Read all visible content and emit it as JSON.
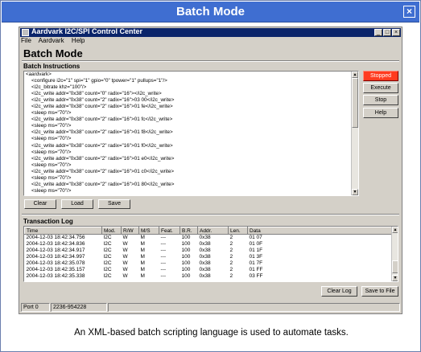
{
  "banner": {
    "title": "Batch Mode",
    "close": "×"
  },
  "window": {
    "title": "Aardvark I2C/SPI Control Center",
    "controls": {
      "minimize": "_",
      "maximize": "□",
      "close": "×"
    },
    "menu": [
      "File",
      "Aardvark",
      "Help"
    ]
  },
  "panel": {
    "title": "Batch Mode",
    "instructions_label": "Batch Instructions",
    "script_lines": [
      "<aardvark>",
      "    <configure i2c=\"1\" spi=\"1\" gpio=\"0\" tpower=\"1\" pullups=\"1\"/>",
      "    <i2c_bitrate khz=\"100\"/>",
      "    <i2c_write addr=\"0x38\" count=\"0\" radix=\"16\"></i2c_write>",
      "    <i2c_write addr=\"0x38\" count=\"2\" radix=\"16\">03 00</i2c_write>",
      "    <i2c_write addr=\"0x38\" count=\"2\" radix=\"16\">01 fe</i2c_write>",
      "    <sleep ms=\"70\"/>",
      "    <i2c_write addr=\"0x38\" count=\"2\" radix=\"16\">01 fc</i2c_write>",
      "    <sleep ms=\"70\"/>",
      "    <i2c_write addr=\"0x38\" count=\"2\" radix=\"16\">01 f8</i2c_write>",
      "    <sleep ms=\"70\"/>",
      "    <i2c_write addr=\"0x38\" count=\"2\" radix=\"16\">01 f0</i2c_write>",
      "    <sleep ms=\"70\"/>",
      "    <i2c_write addr=\"0x38\" count=\"2\" radix=\"16\">01 e0</i2c_write>",
      "    <sleep ms=\"70\"/>",
      "    <i2c_write addr=\"0x38\" count=\"2\" radix=\"16\">01 c0</i2c_write>",
      "    <sleep ms=\"70\"/>",
      "    <i2c_write addr=\"0x38\" count=\"2\" radix=\"16\">01 80</i2c_write>",
      "    <sleep ms=\"70\"/>"
    ],
    "side_buttons": {
      "status": "Stopped",
      "execute": "Execute",
      "stop": "Stop",
      "help": "Help"
    },
    "bottom_buttons": {
      "clear": "Clear",
      "load": "Load",
      "save": "Save"
    },
    "status_color": "#ff3b1f"
  },
  "log": {
    "label": "Transaction Log",
    "columns": [
      "Time",
      "Mod.",
      "R/W",
      "M/S",
      "Feat.",
      "B.R.",
      "Addr.",
      "Len.",
      "Data"
    ],
    "rows": [
      [
        "2004-12-03 18:42:34.756",
        "I2C",
        "W",
        "M",
        "---",
        "100",
        "0x38",
        "2",
        "01 07"
      ],
      [
        "2004-12-03 18:42:34.836",
        "I2C",
        "W",
        "M",
        "---",
        "100",
        "0x38",
        "2",
        "01 0F"
      ],
      [
        "2004-12-03 18:42:34.917",
        "I2C",
        "W",
        "M",
        "---",
        "100",
        "0x38",
        "2",
        "01 1F"
      ],
      [
        "2004-12-03 18:42:34.997",
        "I2C",
        "W",
        "M",
        "---",
        "100",
        "0x38",
        "2",
        "01 3F"
      ],
      [
        "2004-12-03 18:42:35.078",
        "I2C",
        "W",
        "M",
        "---",
        "100",
        "0x38",
        "2",
        "01 7F"
      ],
      [
        "2004-12-03 18:42:35.157",
        "I2C",
        "W",
        "M",
        "---",
        "100",
        "0x38",
        "2",
        "01 FF"
      ],
      [
        "2004-12-03 18:42:35.338",
        "I2C",
        "W",
        "M",
        "---",
        "100",
        "0x38",
        "2",
        "03 FF"
      ]
    ],
    "buttons": {
      "clear": "Clear Log",
      "save": "Save to File"
    }
  },
  "statusbar": {
    "port": "Port 0",
    "serial": "2236-954228"
  },
  "caption": "An XML-based batch scripting language is used to automate tasks.",
  "icons": {
    "banner_close": "close-icon",
    "scroll_up": "arrow-up-icon",
    "scroll_down": "arrow-down-icon"
  }
}
